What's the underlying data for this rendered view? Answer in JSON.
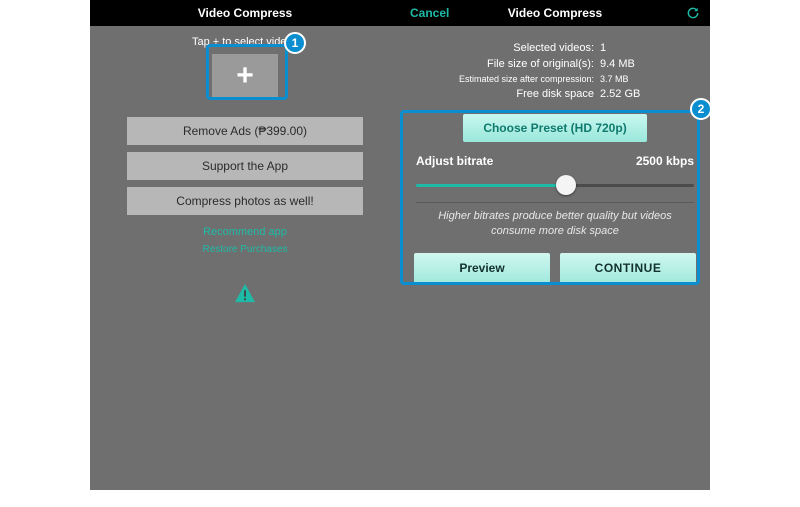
{
  "left": {
    "title": "Video Compress",
    "hint": "Tap + to select videos",
    "buttons": {
      "remove_ads": "Remove Ads (₱399.00)",
      "support": "Support the App",
      "compress_photos": "Compress photos as well!"
    },
    "links": {
      "recommend": "Recommend app",
      "restore": "Restore Purchases"
    }
  },
  "right": {
    "cancel": "Cancel",
    "title": "Video Compress",
    "stats": {
      "selected_label": "Selected videos:",
      "selected_value": "1",
      "original_label": "File size of original(s):",
      "original_value": "9.4 MB",
      "estimated_label": "Estimated size after compression:",
      "estimated_value": "3.7 MB",
      "freespace_label": "Free disk space",
      "freespace_value": "2.52 GB"
    },
    "preset": "Choose Preset (HD 720p)",
    "bitrate_label": "Adjust bitrate",
    "bitrate_value": "2500 kbps",
    "note": "Higher bitrates produce better quality but videos consume more disk space",
    "preview": "Preview",
    "continue": "CONTINUE"
  },
  "annotations": {
    "one": "1",
    "two": "2"
  }
}
